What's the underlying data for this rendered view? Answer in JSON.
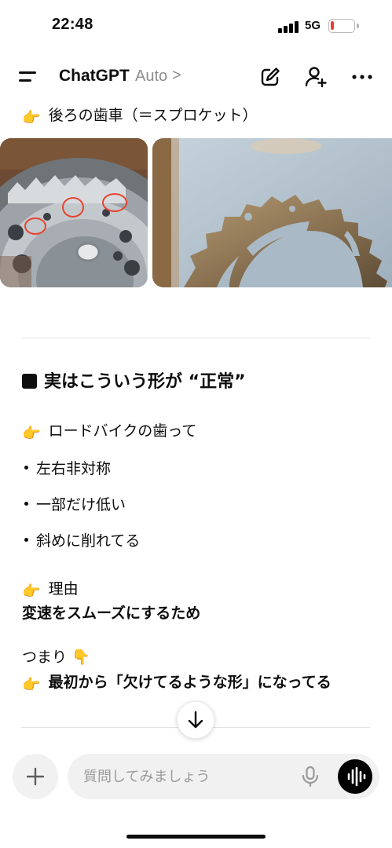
{
  "status_bar": {
    "time": "22:48",
    "network": "5G"
  },
  "header": {
    "title": "ChatGPT",
    "model": "Auto",
    "chevron": ">"
  },
  "chat": {
    "top_line": {
      "emoji": "👉",
      "text": "後ろの歯車（＝スプロケット）"
    },
    "heading": {
      "text": "実はこういう形が “正常”"
    },
    "intro": {
      "emoji": "👉",
      "text": "ロードバイクの歯って"
    },
    "bullets": [
      "左右非対称",
      "一部だけ低い",
      "斜めに削れてる"
    ],
    "reason": {
      "emoji": "👉",
      "label": "理由",
      "text": "変速をスムーズにするため"
    },
    "conclusion": {
      "line1": "つまり",
      "line1_emoji": "👇",
      "emoji": "👉",
      "line2": "最初から「欠けてるような形」になってる"
    }
  },
  "composer": {
    "placeholder": "質問してみましょう"
  },
  "icons": {
    "menu": "menu-icon",
    "new_chat": "edit-icon",
    "add_person": "add-person-icon",
    "more": "more-icon",
    "scroll_down": "arrow-down-icon",
    "plus": "plus-icon",
    "mic": "mic-icon",
    "voice": "voice-wave-icon"
  },
  "colors": {
    "accent_red": "#e8432f",
    "secondary_text": "#8d8d8d",
    "composer_bg": "#f1f1f1"
  }
}
